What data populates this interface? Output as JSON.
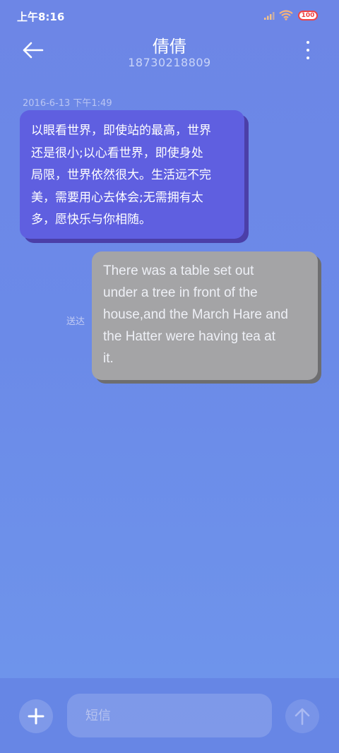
{
  "status_bar": {
    "time": "上午8:16",
    "battery": "100",
    "icons": [
      "signal-icon",
      "wifi-icon",
      "battery-icon"
    ]
  },
  "header": {
    "contact_name": "倩倩",
    "phone_number": "18730218809",
    "icons": [
      "back-arrow-icon",
      "more-vertical-icon"
    ]
  },
  "conversation": {
    "timestamp": "2016-6-13 下午1:49",
    "messages": [
      {
        "direction": "incoming",
        "lines": [
          "以眼看世界，即使站的最高，世界",
          "还是很小;以心看世界，即使身处",
          "局限，世界依然很大。生活远不完",
          "美，需要用心去体会;无需拥有太",
          "多，愿快乐与你相随。"
        ]
      },
      {
        "direction": "outgoing",
        "status": "送达",
        "lines": [
          "There was a table set out",
          "under a tree in front of the",
          "house,and the March Hare and",
          "the Hatter were having tea at",
          "it."
        ]
      }
    ]
  },
  "composer": {
    "placeholder": "短信",
    "value": "",
    "icons": [
      "plus-icon",
      "send-arrow-icon"
    ]
  },
  "colors": {
    "incoming_bubble": "#5f5fe0",
    "outgoing_bubble": "#a4a4a6",
    "background": "#6d86e6"
  }
}
